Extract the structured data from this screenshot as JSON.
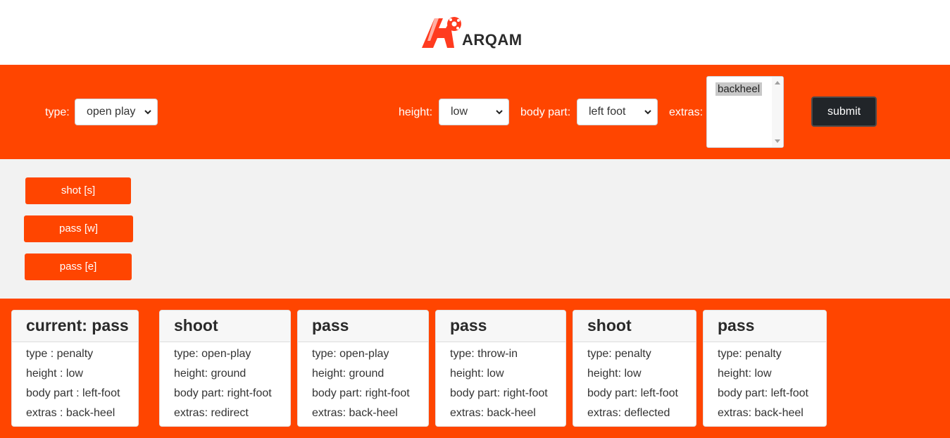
{
  "header": {
    "logo_text": "ARQAM"
  },
  "form": {
    "type_label": "type:",
    "type_value": "open play",
    "height_label": "height:",
    "height_value": "low",
    "body_part_label": "body part:",
    "body_part_value": "left foot",
    "extras_label": "extras:",
    "extras_selected": "backheel",
    "submit_label": "submit"
  },
  "actions": [
    {
      "label": "shot [s]"
    },
    {
      "label": "pass [w]"
    },
    {
      "label": "pass [e]"
    }
  ],
  "cards": [
    {
      "title": "current: pass",
      "lines": [
        "type : penalty",
        "height : low",
        "body part : left-foot",
        "extras : back-heel"
      ]
    },
    {
      "title": "shoot",
      "lines": [
        "type: open-play",
        "height: ground",
        "body part: right-foot",
        "extras: redirect"
      ]
    },
    {
      "title": "pass",
      "lines": [
        "type: open-play",
        "height: ground",
        "body part: right-foot",
        "extras: back-heel"
      ]
    },
    {
      "title": "pass",
      "lines": [
        "type: throw-in",
        "height: low",
        "body part: right-foot",
        "extras: back-heel"
      ]
    },
    {
      "title": "shoot",
      "lines": [
        "type: penalty",
        "height: low",
        "body part: left-foot",
        "extras: deflected"
      ]
    },
    {
      "title": "pass",
      "lines": [
        "type: penalty",
        "height: low",
        "body part: left-foot",
        "extras: back-heel"
      ]
    }
  ],
  "colors": {
    "accent": "#ff4500",
    "dark_button": "#212529",
    "panel": "#f2f2f2"
  },
  "icons": {
    "logo": "arqam-logo-icon",
    "select_caret": "chevron-down-icon"
  }
}
